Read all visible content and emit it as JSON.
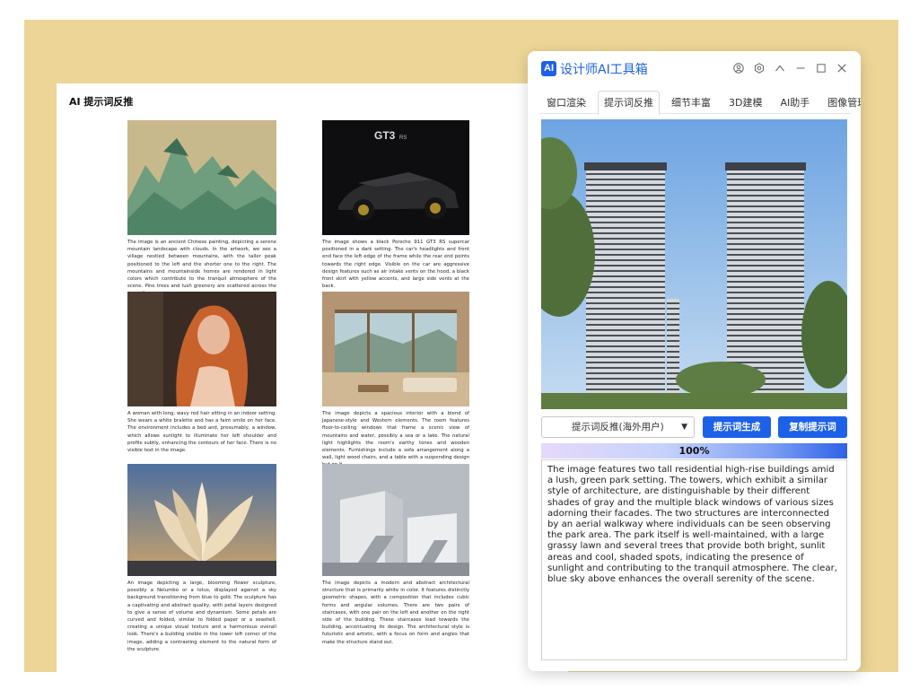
{
  "document": {
    "title": "AI 提示词反推",
    "cards": [
      {
        "image": "ancient-chinese-landscape-painting",
        "text": "The image is an ancient Chinese painting, depicting a serene mountain landscape with clouds. In the artwork, we see a village nestled between mountains, with the taller peak positioned to the left and the shorter one to the right. The mountains and mountainside homes are rendered in light colors which contribute to the tranquil atmosphere of the scene. Pine trees and lush greenery are scattered across the summits."
      },
      {
        "image": "black-porsche-gt3-rs",
        "text": "The image shows a black Porsche 911 GT3 RS supercar positioned in a dark setting. The car's headlights and front end face the left edge of the frame while the rear end points towards the right edge. Visible on the car are aggressive design features such as air intake vents on the hood, a black front skirt with yellow accents, and large side vents at the back."
      },
      {
        "image": "red-haired-woman-portrait",
        "text": "A woman with long, wavy red hair sitting in an indoor setting. She wears a white bralette and has a faint smile on her face. The environment includes a bed and, presumably, a window, which allows sunlight to illuminate her left shoulder and profile subtly, enhancing the contours of her face. There is no visible text in the image."
      },
      {
        "image": "japanese-style-interior",
        "text": "The image depicts a spacious interior with a blend of Japanese-style and Western elements. The room features floor-to-ceiling windows that frame a scenic view of mountains and water, possibly a sea or a lake. The natural light highlights the room's earthy tones and wooden elements. Furnishings include a sofa arrangement along a wall, light wood chairs, and a table with a suspending design hut on it."
      },
      {
        "image": "flower-sculpture",
        "text": "An image depicting a large, blooming flower sculpture, possibly a Nelumbo or a lotus, displayed against a sky background transitioning from blue to gold. The sculpture has a captivating and abstract quality, with petal layers designed to give a sense of volume and dynamism. Some petals are curved and folded, similar to folded paper or a seashell, creating a unique visual texture and a harmonious overall look. There's a building visible in the lower left corner of the image, adding a contrasting element to the natural form of the sculpture."
      },
      {
        "image": "white-abstract-architecture",
        "text": "The image depicts a modern and abstract architectural structure that is primarily white in color. It features distinctly geometric shapes, with a composition that includes cubic forms and angular volumes. There are two pairs of staircases, with one pair on the left and another on the right side of the building. These staircases lead towards the building, accentuating its design. The architectural style is futuristic and artistic, with a focus on form and angles that make the structure stand out."
      }
    ]
  },
  "window": {
    "logo": "AI",
    "title": "设计师AI工具箱",
    "header_icons": [
      "user-icon",
      "settings-icon",
      "collapse-icon",
      "minimize-icon",
      "maximize-icon",
      "close-icon"
    ],
    "tabs": [
      {
        "label": "窗口渲染",
        "active": false
      },
      {
        "label": "提示词反推",
        "active": true
      },
      {
        "label": "细节丰富",
        "active": false
      },
      {
        "label": "3D建模",
        "active": false
      },
      {
        "label": "AI助手",
        "active": false
      },
      {
        "label": "图像管理",
        "active": false
      }
    ],
    "preview_image": "two-residential-high-rise-towers",
    "mode_select": "提示词反推(海外用户)",
    "generate_button": "提示词生成",
    "copy_button": "复制提示词",
    "progress": {
      "value": 100,
      "label": "100%"
    },
    "output_text": "The image features two tall residential high-rise buildings amid a lush, green park setting. The towers, which exhibit a similar style of architecture, are distinguishable by their different shades of gray and the multiple black windows of various sizes adorning their facades. The two structures are interconnected by an aerial walkway where individuals can be seen observing the park area. The park itself is well-maintained, with a large grassy lawn and several trees that provide both bright, sunlit areas and cool, shaded spots, indicating the presence of sunlight and contributing to the tranquil atmosphere. The clear, blue sky above enhances the overall serenity of the scene."
  },
  "colors": {
    "accent": "#1d61e8",
    "background": "#ecd597"
  }
}
